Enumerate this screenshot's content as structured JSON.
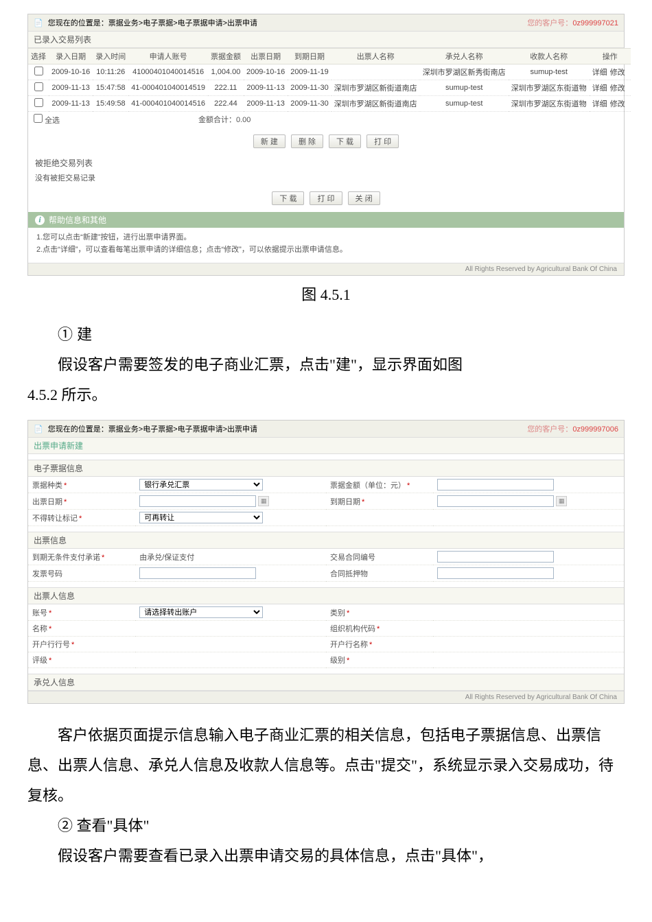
{
  "screenshot1": {
    "breadcrumb": "您现在的位置是：票据业务>电子票据>电子票据申请>出票申请",
    "customer_label": "您的客户号：",
    "customer_id": "0z999997021",
    "section_entered": "已录入交易列表",
    "headers": [
      "选择",
      "录入日期",
      "录入时间",
      "申请人账号",
      "票据金额",
      "出票日期",
      "到期日期",
      "出票人名称",
      "承兑人名称",
      "收款人名称",
      "操作"
    ],
    "rows": [
      {
        "date": "2009-10-16",
        "time": "10:11:26",
        "acct": "41000401040014516",
        "amt": "1,004.00",
        "issue": "2009-10-16",
        "due": "2009-11-19",
        "drawer": "",
        "acceptor": "深圳市罗湖区新秀街南店",
        "payee": "sumup-test",
        "ops": [
          "详细",
          "修改"
        ]
      },
      {
        "date": "2009-11-13",
        "time": "15:47:58",
        "acct": "41-000401040014519",
        "amt": "222.11",
        "issue": "2009-11-13",
        "due": "2009-11-30",
        "drawer": "深圳市罗湖区新街道南店",
        "acceptor": "sumup-test",
        "payee": "深圳市罗湖区东街道物",
        "ops": [
          "详细",
          "修改"
        ]
      },
      {
        "date": "2009-11-13",
        "time": "15:49:58",
        "acct": "41-000401040014516",
        "amt": "222.44",
        "issue": "2009-11-13",
        "due": "2009-11-30",
        "drawer": "深圳市罗湖区新街道南店",
        "acceptor": "sumup-test",
        "payee": "深圳市罗湖区东街道物",
        "ops": [
          "详细",
          "修改"
        ]
      }
    ],
    "select_all": "全选",
    "total_label": "金额合计：0.00",
    "btns_mid": [
      "新 建",
      "删 除",
      "下 载",
      "打 印"
    ],
    "section_rejected": "被拒绝交易列表",
    "no_rejected": "没有被拒交易记录",
    "btns_low": [
      "下 载",
      "打 印",
      "关 闭"
    ],
    "tips_title": "帮助信息和其他",
    "tips": [
      "1.您可以点击“新建”按钮，进行出票申请界面。",
      "2.点击“详细”，可以查看每笔出票申请的详细信息；点击“修改”，可以依据提示出票申请信息。"
    ],
    "footer": "All Rights Reserved by Agricultural Bank Of China"
  },
  "caption1": "图 4.5.1",
  "doc": {
    "p1": "① 建",
    "p2": "假设客户需要签发的电子商业汇票，点击\"建\"，显示界面如图",
    "p3": "4.5.2 所示。"
  },
  "screenshot2": {
    "breadcrumb": "您现在的位置是：票据业务>电子票据>电子票据申请>出票申请",
    "customer_label": "您的客户号：",
    "customer_id": "0z999997006",
    "tab": "出票申请新建",
    "sec_bill": "电子票据信息",
    "bill_type_label": "票据种类",
    "bill_type_value": "银行承兑汇票",
    "amount_label": "票据金额（单位：元）",
    "issue_date_label": "出票日期",
    "due_date_label": "到期日期",
    "no_transfer_label": "不得转让标记",
    "no_transfer_value": "可再转让",
    "sec_issue": "出票信息",
    "pay_promise_label": "到期无条件支付承诺",
    "pay_promise_value": "由承兑/保证支付",
    "contract_label": "交易合同编号",
    "invoice_label": "发票号码",
    "pledge_label": "合同抵押物",
    "sec_drawer": "出票人信息",
    "acct_label": "账号",
    "acct_placeholder": "请选择转出账户",
    "type_label": "类别",
    "name_label": "名称",
    "org_label": "组织机构代码",
    "bankno_label": "开户行行号",
    "bankname_label": "开户行名称",
    "rater_label": "评级",
    "rating_label": "级别",
    "sec_acceptor": "承兑人信息",
    "footer": "All Rights Reserved by Agricultural Bank Of China"
  },
  "doc2": {
    "p1": "客户依据页面提示信息输入电子商业汇票的相关信息，包括电子票据信息、出票信息、出票人信息、承兑人信息及收款人信息等。点击\"提交\"，系统显示录入交易成功，待复核。",
    "p2": "② 查看\"具体\"",
    "p3": "假设客户需要查看已录入出票申请交易的具体信息，点击\"具体\"，"
  }
}
